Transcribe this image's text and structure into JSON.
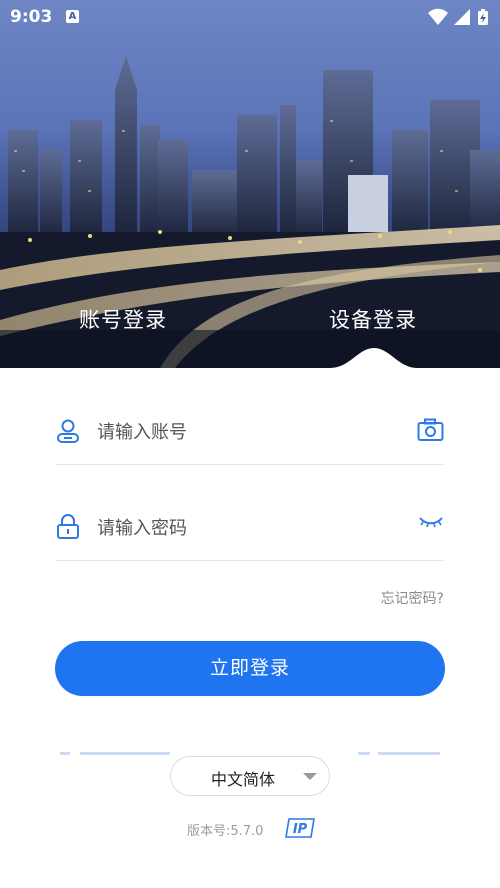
{
  "status_bar": {
    "time": "9:03",
    "notification_glyph": "A",
    "icons": [
      "wifi-icon",
      "signal-icon",
      "battery-charging-icon"
    ]
  },
  "tabs": {
    "account_login": "账号登录",
    "device_login": "设备登录",
    "active": "device_login"
  },
  "form": {
    "account_placeholder": "请输入账号",
    "password_placeholder": "请输入密码",
    "account_icon": "user-icon",
    "scan_icon": "camera-icon",
    "password_icon": "lock-icon",
    "visibility_icon": "eye-closed-icon",
    "forgot_password": "忘记密码?",
    "submit_label": "立即登录"
  },
  "language": {
    "selected": "中文简体"
  },
  "footer": {
    "version": "版本号:5.7.0",
    "ip_badge": "IP"
  },
  "colors": {
    "primary": "#1f74f0",
    "icon_blue": "#2f7ae5"
  }
}
